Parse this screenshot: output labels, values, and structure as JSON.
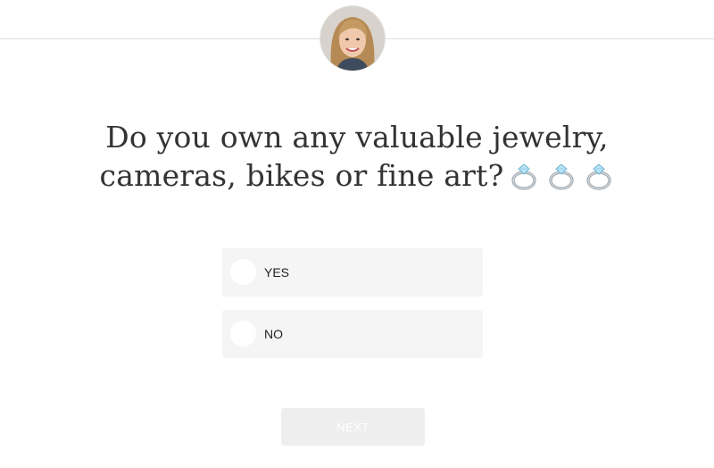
{
  "header": {
    "avatar_icon": "agent-avatar-icon"
  },
  "question": {
    "line1": "Do you own any valuable jewelry,",
    "line2": "cameras, bikes or fine art?",
    "emoji_icon": "ring-icon",
    "emoji_count": 3
  },
  "options": [
    {
      "label": "YES",
      "selected": false
    },
    {
      "label": "NO",
      "selected": false
    }
  ],
  "footer": {
    "next_label": "NEXT",
    "next_enabled": false
  },
  "colors": {
    "option_background": "#f5f5f5",
    "radio_fill": "#ffffff",
    "next_button_disabled": "#eeeeee",
    "divider": "#dddddd",
    "text": "#333333"
  }
}
